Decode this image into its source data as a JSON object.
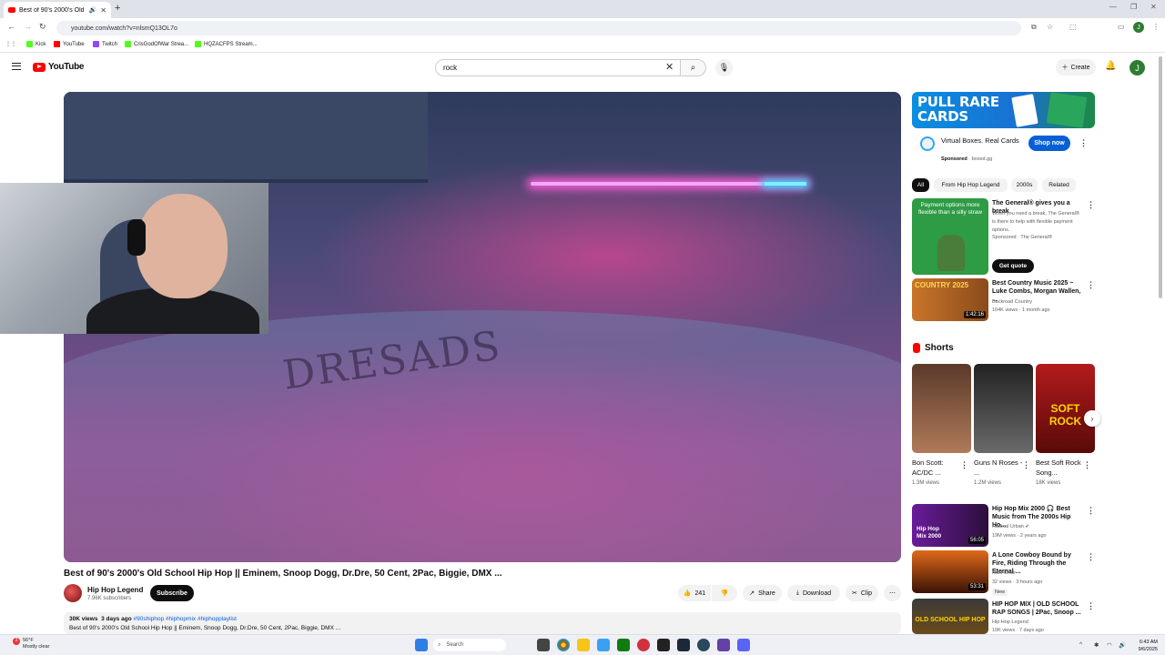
{
  "browser": {
    "tab_title": "Best of 90's 2000's Old Scho",
    "url": "youtube.com/watch?v=nlsmQ13OL7o",
    "bookmarks": [
      "Kick",
      "YouTube",
      "Twitch",
      "CrisGodOfWar Strea...",
      "HQZACFPS Stream..."
    ],
    "profile_initial": "J"
  },
  "header": {
    "logo_text": "YouTube",
    "search_value": "rock",
    "create_label": "Create",
    "avatar_initial": "J"
  },
  "video": {
    "title": "Best of 90's 2000's Old School Hip Hop || Eminem, Snoop Dogg, Dr.Dre, 50 Cent, 2Pac, Biggie, DMX ...",
    "channel": "Hip Hop Legend",
    "subscribers": "7.96K subscribers",
    "subscribe_label": "Subscribe",
    "likes": "241",
    "share_label": "Share",
    "download_label": "Download",
    "clip_label": "Clip",
    "views": "30K views",
    "posted": "3 days ago",
    "tags": "#90shiphop #hiphopmix #hiphopplaylist",
    "description": "Best of 90's 2000's Old School Hip Hop || Eminem, Snoop Dogg, Dr.Dre, 50 Cent, 2Pac, Biggie, DMX ...",
    "graffiti": "DRESADS"
  },
  "ad": {
    "banner_line1": "PULL RARE",
    "banner_line2": "CARDS",
    "title": "Virtual Boxes. Real Cards",
    "sponsored": "Sponsored",
    "domain": "boxed.gg",
    "cta": "Shop now"
  },
  "chips": [
    "All",
    "From Hip Hop Legend",
    "2000s",
    "Related"
  ],
  "recommended_top": [
    {
      "title": "The General® gives you a break",
      "meta1": "When you need a break, The General® is there to help with flexible payment options.",
      "meta2": "Sponsored · The General®",
      "thumb_text": "Payment options more flexible than a silly straw",
      "cta": "Get quote"
    },
    {
      "title": "Best Country Music 2025 ~ Luke Combs, Morgan Wallen, ...",
      "channel": "Backroad Country",
      "meta": "104K views · 1 month ago",
      "duration": "1:42:16",
      "thumb_text": "COUNTRY 2025"
    }
  ],
  "shorts": {
    "heading": "Shorts",
    "items": [
      {
        "title": "Bon Scott: AC/DC ...",
        "views": "1.3M views"
      },
      {
        "title": "Guns N Roses - ...",
        "views": "1.2M views"
      },
      {
        "title": "Best Soft Rock Song...",
        "views": "18K views",
        "thumb_text": "SOFT ROCK"
      }
    ]
  },
  "recommended_bottom": [
    {
      "title": "Hip Hop Mix 2000 🎧 Best Music from The 2000s Hip Ho...",
      "channel": "Radical Urban",
      "meta": "19M views · 2 years ago",
      "duration": "56:05",
      "thumb_text": "Hip Hop Mix 2000"
    },
    {
      "title": "A Lone Cowboy Bound by Fire, Riding Through the Eternal ...",
      "channel": "Rust Choir",
      "meta": "32 views · 3 hours ago",
      "badge": "New",
      "duration": "53:31"
    },
    {
      "title": "HIP HOP MIX | OLD SCHOOL RAP SONGS | 2Pac, Snoop ...",
      "channel": "Hip Hop Legend",
      "meta": "10K views · 7 days ago",
      "thumb_text": "OLD SCHOOL HIP HOP"
    }
  ],
  "taskbar": {
    "temp": "56°F",
    "weather": "Mostly clear",
    "badge": "3",
    "search_label": "Search",
    "time": "6:43 AM",
    "date": "9/6/2025"
  }
}
